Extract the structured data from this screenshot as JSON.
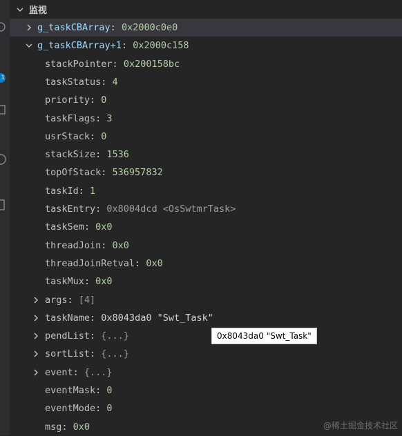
{
  "section": {
    "title": "监视"
  },
  "activity": {
    "badge": "1"
  },
  "tree": [
    {
      "name": "g_taskCBArray",
      "value": "0x2000c0e0",
      "expander": "collapsed"
    },
    {
      "name": "g_taskCBArray+1",
      "value": "0x2000c158",
      "expander": "expanded"
    },
    {
      "name": "stackPointer",
      "value": "0x200158bc",
      "expander": "none"
    },
    {
      "name": "taskStatus",
      "value": "4",
      "expander": "none"
    },
    {
      "name": "priority",
      "value": "0",
      "expander": "none"
    },
    {
      "name": "taskFlags",
      "value": "3",
      "expander": "none"
    },
    {
      "name": "usrStack",
      "value": "0",
      "expander": "none"
    },
    {
      "name": "stackSize",
      "value": "1536",
      "expander": "none"
    },
    {
      "name": "topOfStack",
      "value": "536957832",
      "expander": "none"
    },
    {
      "name": "taskId",
      "value": "1",
      "expander": "none"
    },
    {
      "name": "taskEntry",
      "value": "0x8004dcd <OsSwtmrTask>",
      "expander": "none"
    },
    {
      "name": "taskSem",
      "value": "0x0",
      "expander": "none"
    },
    {
      "name": "threadJoin",
      "value": "0x0",
      "expander": "none"
    },
    {
      "name": "threadJoinRetval",
      "value": "0x0",
      "expander": "none"
    },
    {
      "name": "taskMux",
      "value": "0x0",
      "expander": "none"
    },
    {
      "name": "args",
      "value": "[4]",
      "expander": "collapsed"
    },
    {
      "name": "taskName",
      "value": "0x8043da0 \"Swt_Task\"",
      "expander": "collapsed"
    },
    {
      "name": "pendList",
      "value": "{...}",
      "expander": "collapsed"
    },
    {
      "name": "sortList",
      "value": "{...}",
      "expander": "collapsed"
    },
    {
      "name": "event",
      "value": "{...}",
      "expander": "collapsed"
    },
    {
      "name": "eventMask",
      "value": "0",
      "expander": "none"
    },
    {
      "name": "eventMode",
      "value": "0",
      "expander": "none"
    },
    {
      "name": "msg",
      "value": "0x0",
      "expander": "none"
    }
  ],
  "tooltip": {
    "text": "0x8043da0 \"Swt_Task\""
  },
  "watermark": {
    "text": "@稀土掘金技术社区"
  },
  "colors": {
    "background": "#252526",
    "selected_row": "#37373d",
    "variable_name": "#9cdcfe",
    "number_value": "#b5cea8",
    "string_value": "#d4d4d4",
    "structured_value": "#9d9d9d"
  }
}
